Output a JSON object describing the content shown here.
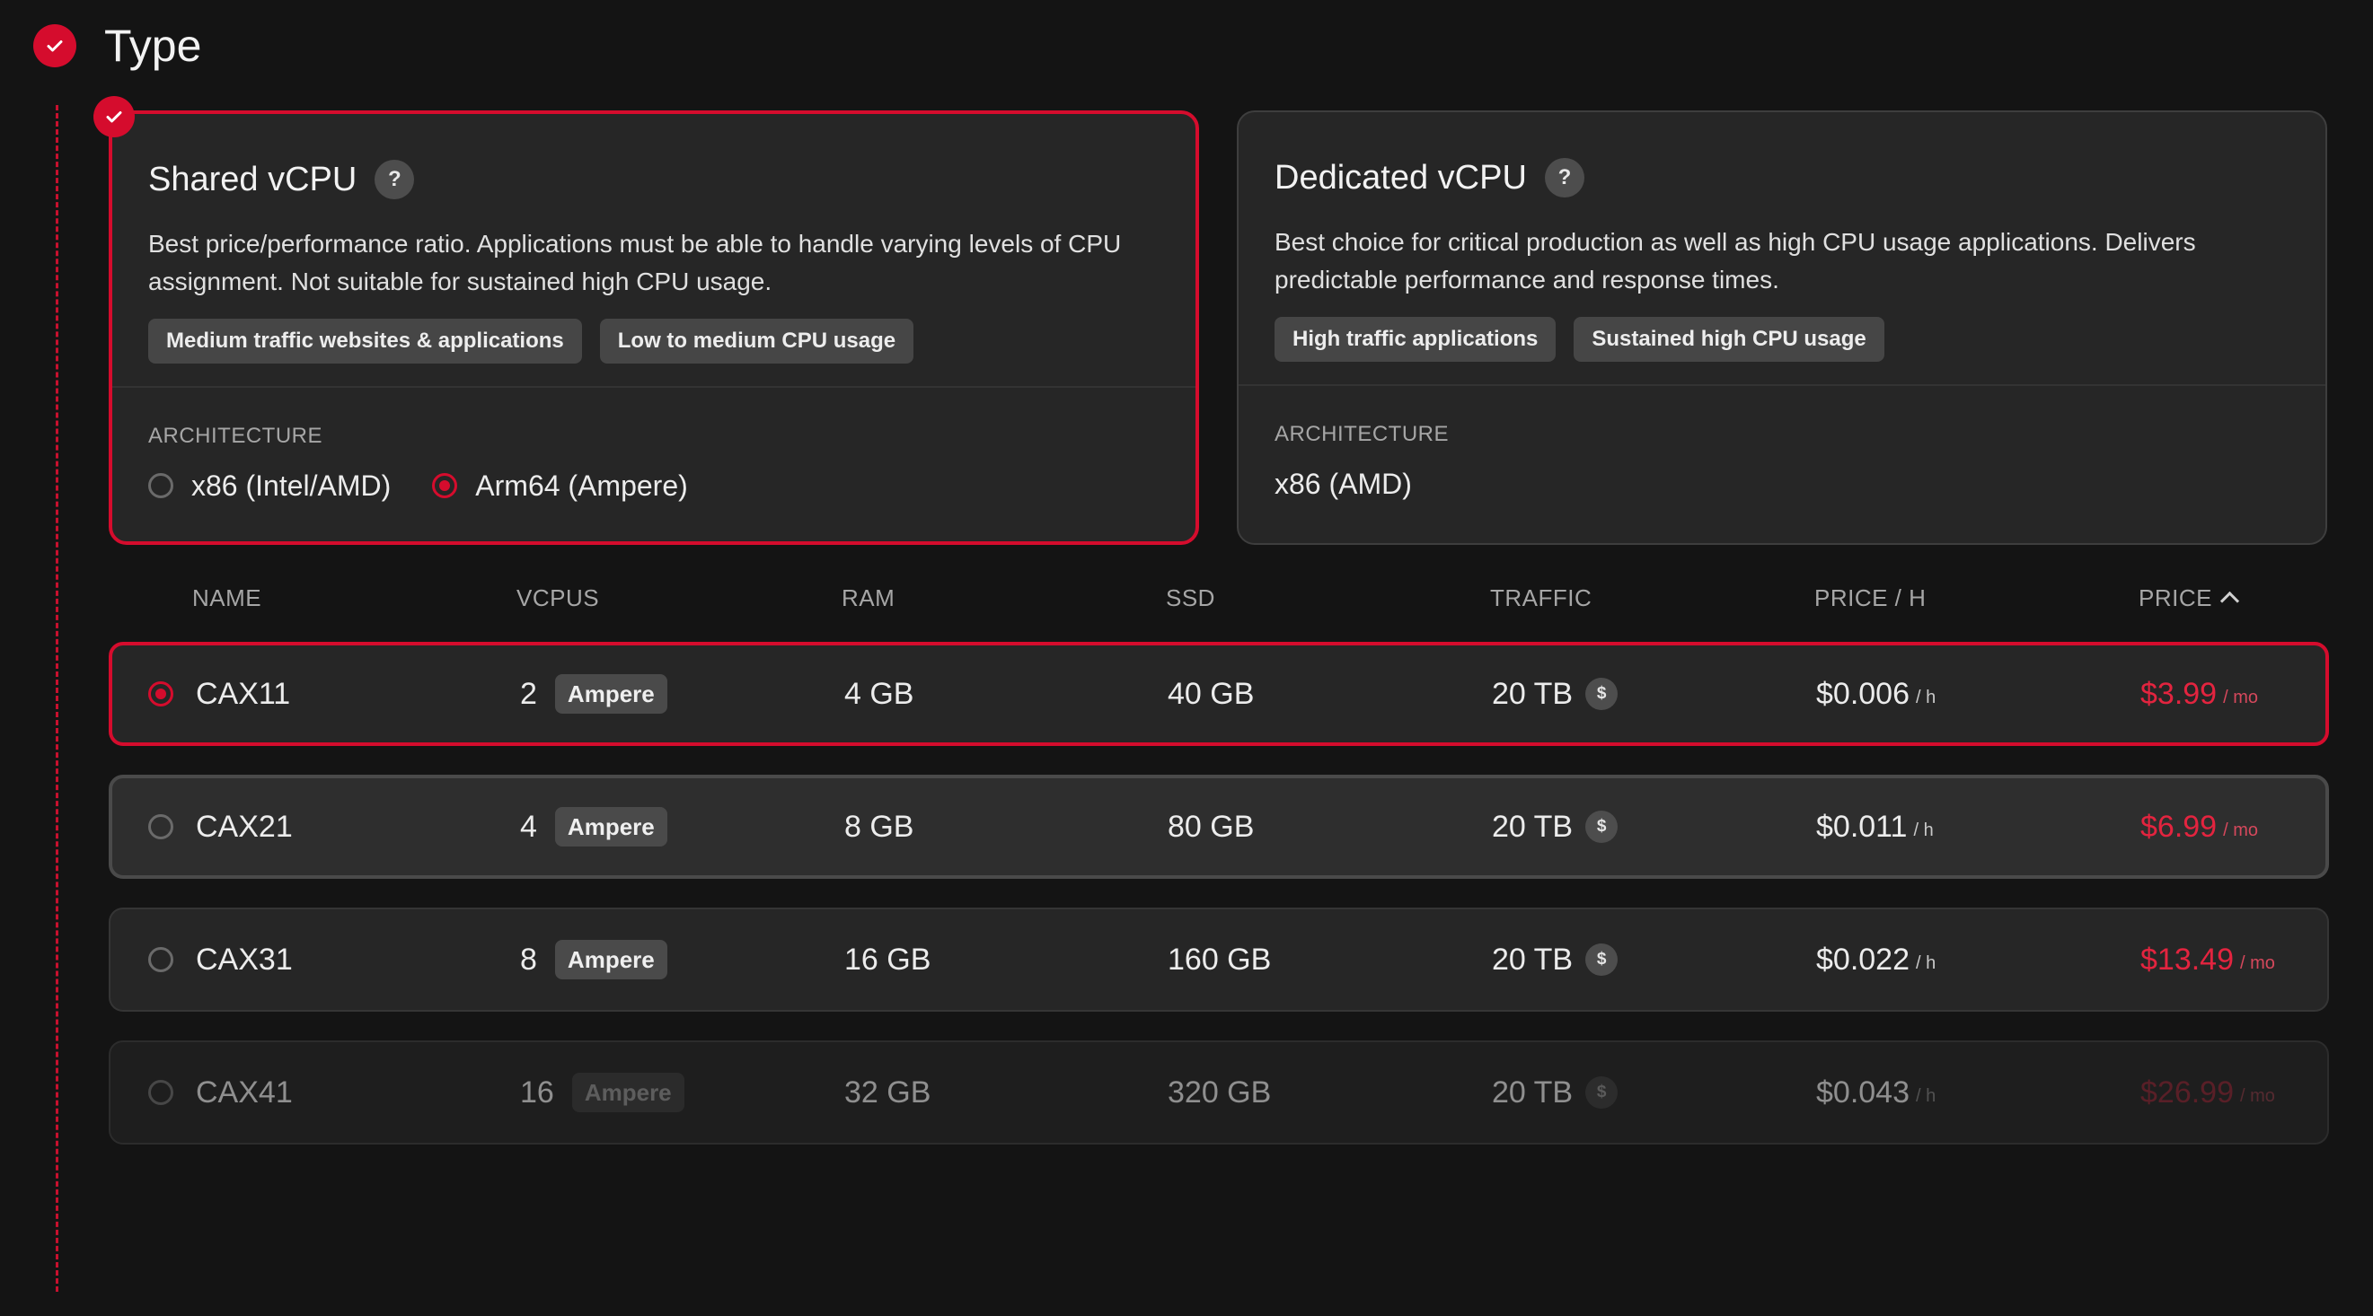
{
  "section": {
    "title": "Type"
  },
  "cards": [
    {
      "title": "Shared vCPU",
      "help": "?",
      "description": "Best price/performance ratio. Applications must be able to handle varying levels of CPU assignment. Not suitable for sustained high CPU usage.",
      "tags": [
        "Medium traffic websites & applications",
        "Low to medium CPU usage"
      ],
      "arch_label": "ARCHITECTURE",
      "arch_options": [
        {
          "label": "x86 (Intel/AMD)",
          "selected": false
        },
        {
          "label": "Arm64 (Ampere)",
          "selected": true
        }
      ],
      "selected": true
    },
    {
      "title": "Dedicated vCPU",
      "help": "?",
      "description": "Best choice for critical production as well as high CPU usage applications. Delivers predictable performance and response times.",
      "tags": [
        "High traffic applications",
        "Sustained high CPU usage"
      ],
      "arch_label": "ARCHITECTURE",
      "arch_value": "x86 (AMD)",
      "selected": false
    }
  ],
  "table": {
    "headers": {
      "name": "NAME",
      "vcpus": "VCPUS",
      "ram": "RAM",
      "ssd": "SSD",
      "traffic": "TRAFFIC",
      "price_h": "PRICE / H",
      "price": "PRICE"
    },
    "sort": {
      "column": "price",
      "direction": "ascending"
    },
    "rows": [
      {
        "name": "CAX11",
        "vcpus": "2",
        "badge": "Ampere",
        "ram": "4 GB",
        "ssd": "40 GB",
        "traffic": "20 TB",
        "traffic_icon": "$",
        "price_h": "$0.006",
        "price_h_unit": "/ h",
        "price": "$3.99",
        "price_unit": "/ mo",
        "state": "selected"
      },
      {
        "name": "CAX21",
        "vcpus": "4",
        "badge": "Ampere",
        "ram": "8 GB",
        "ssd": "80 GB",
        "traffic": "20 TB",
        "traffic_icon": "$",
        "price_h": "$0.011",
        "price_h_unit": "/ h",
        "price": "$6.99",
        "price_unit": "/ mo",
        "state": "hover"
      },
      {
        "name": "CAX31",
        "vcpus": "8",
        "badge": "Ampere",
        "ram": "16 GB",
        "ssd": "160 GB",
        "traffic": "20 TB",
        "traffic_icon": "$",
        "price_h": "$0.022",
        "price_h_unit": "/ h",
        "price": "$13.49",
        "price_unit": "/ mo",
        "state": "normal"
      },
      {
        "name": "CAX41",
        "vcpus": "16",
        "badge": "Ampere",
        "ram": "32 GB",
        "ssd": "320 GB",
        "traffic": "20 TB",
        "traffic_icon": "$",
        "price_h": "$0.043",
        "price_h_unit": "/ h",
        "price": "$26.99",
        "price_unit": "/ mo",
        "state": "disabled"
      }
    ]
  },
  "colors": {
    "accent": "#d50c2d",
    "background": "#141414",
    "card": "#262626"
  }
}
